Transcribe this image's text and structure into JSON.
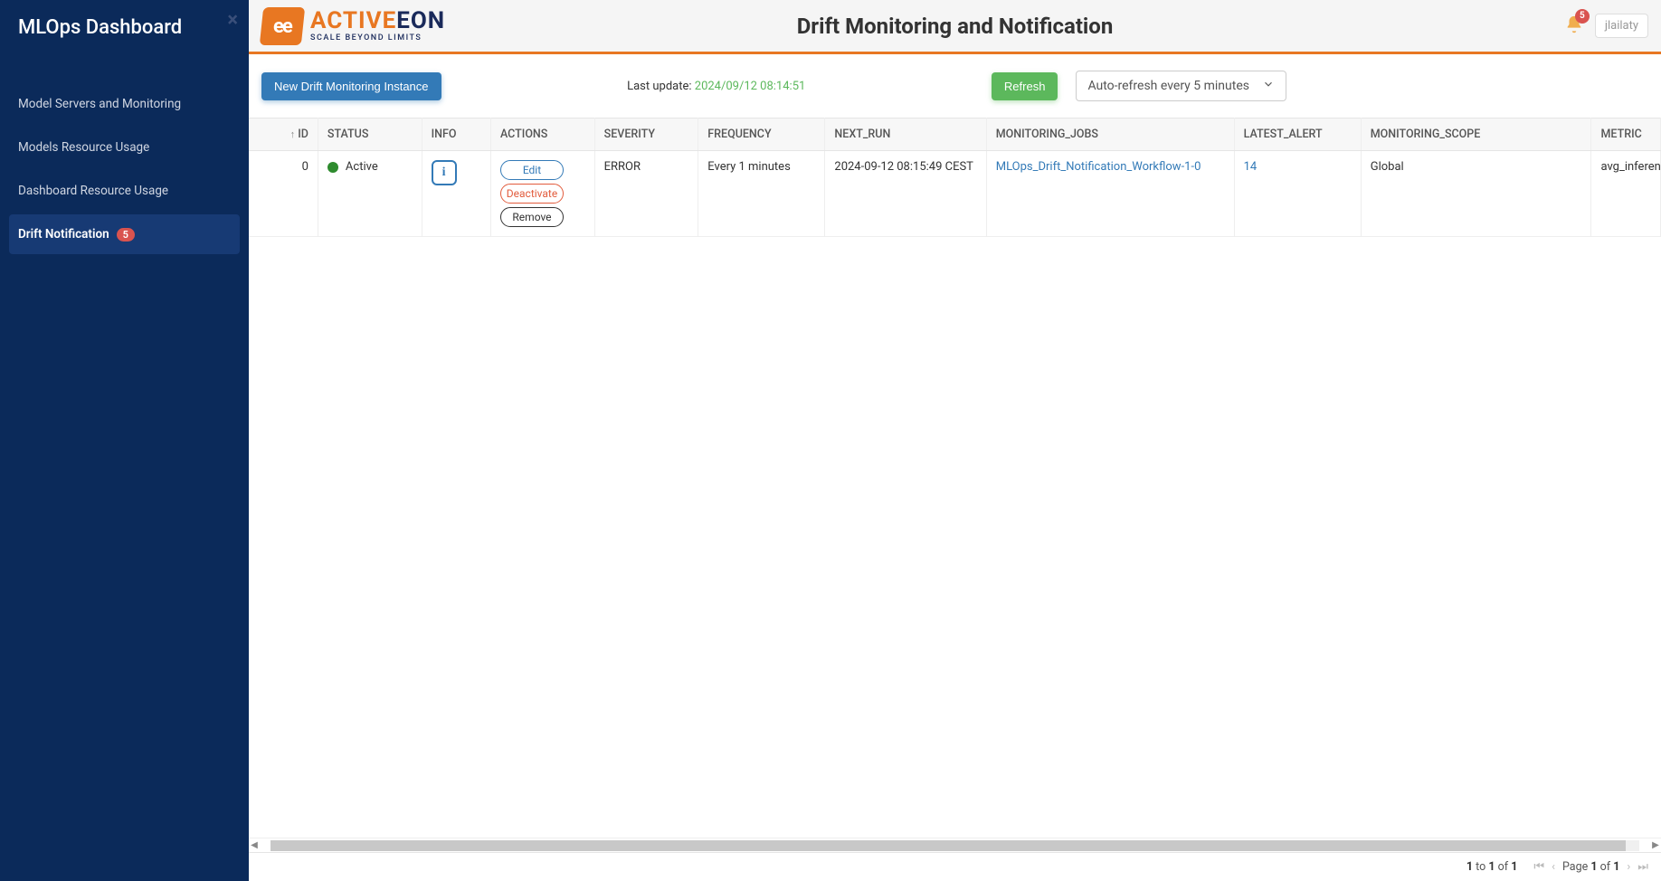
{
  "sidebar": {
    "title": "MLOps Dashboard",
    "items": [
      {
        "label": "Model Servers and Monitoring",
        "active": false,
        "badge": null
      },
      {
        "label": "Models Resource Usage",
        "active": false,
        "badge": null
      },
      {
        "label": "Dashboard Resource Usage",
        "active": false,
        "badge": null
      },
      {
        "label": "Drift Notification",
        "active": true,
        "badge": "5"
      }
    ]
  },
  "header": {
    "logo_main_a": "ACTIVE",
    "logo_main_b": "EON",
    "logo_sub": "SCALE BEYOND LIMITS",
    "page_title": "Drift Monitoring and Notification",
    "bell_badge": "5",
    "user": "jlailaty"
  },
  "toolbar": {
    "new_instance": "New Drift Monitoring Instance",
    "last_update_label": "Last update: ",
    "last_update_ts": "2024/09/12 08:14:51",
    "refresh": "Refresh",
    "autorefresh": "Auto-refresh every 5 minutes"
  },
  "table": {
    "columns": {
      "id": "ID",
      "status": "STATUS",
      "info": "INFO",
      "actions": "ACTIONS",
      "severity": "SEVERITY",
      "frequency": "FREQUENCY",
      "next_run": "NEXT_RUN",
      "monitoring_jobs": "MONITORING_JOBS",
      "latest_alert": "LATEST_ALERT",
      "monitoring_scope": "MONITORING_SCOPE",
      "metric": "METRIC"
    },
    "rows": [
      {
        "id": "0",
        "status": "Active",
        "actions": {
          "edit": "Edit",
          "deactivate": "Deactivate",
          "remove": "Remove"
        },
        "severity": "ERROR",
        "frequency": "Every 1 minutes",
        "next_run": "2024-09-12 08:15:49 CEST",
        "monitoring_jobs": "MLOps_Drift_Notification_Workflow-1-0",
        "latest_alert": "14",
        "monitoring_scope": "Global",
        "metric": "avg_inference"
      }
    ]
  },
  "pagination": {
    "range_from": "1",
    "range_to": "1",
    "range_of": "1",
    "to_word": " to ",
    "of_word": " of ",
    "page_label": "Page ",
    "page_cur": "1",
    "page_of_word": " of ",
    "page_total": "1"
  }
}
